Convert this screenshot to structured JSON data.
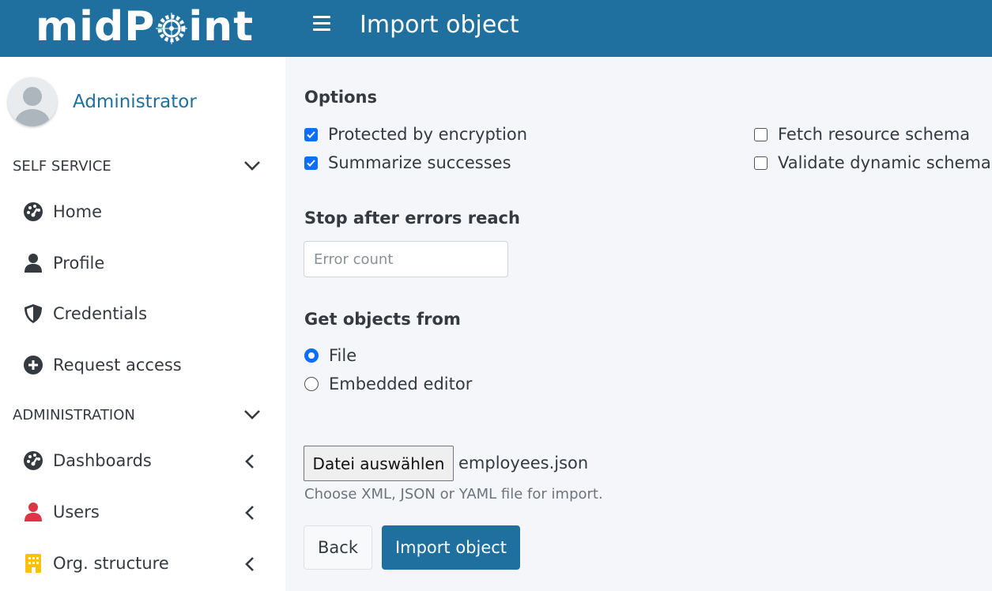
{
  "header": {
    "logo_text_left": "midP",
    "logo_text_right": "int",
    "page_title": "Import object"
  },
  "sidebar": {
    "user_name": "Administrator",
    "sections": [
      {
        "label": "SELF SERVICE",
        "expanded": true
      },
      {
        "label": "ADMINISTRATION",
        "expanded": true
      }
    ],
    "self_service_items": [
      {
        "label": "Home",
        "icon": "dashboard-gauge-icon"
      },
      {
        "label": "Profile",
        "icon": "user-icon"
      },
      {
        "label": "Credentials",
        "icon": "shield-icon"
      },
      {
        "label": "Request access",
        "icon": "plus-circle-icon"
      }
    ],
    "admin_items": [
      {
        "label": "Dashboards",
        "icon": "dashboard-gauge-icon",
        "color": "#343a40"
      },
      {
        "label": "Users",
        "icon": "user-icon",
        "color": "#dc3545"
      },
      {
        "label": "Org. structure",
        "icon": "building-icon",
        "color": "#ffc107"
      }
    ]
  },
  "main": {
    "options_heading": "Options",
    "options": [
      {
        "label": "Protected by encryption",
        "checked": true
      },
      {
        "label": "Summarize successes",
        "checked": true
      },
      {
        "label": "Fetch resource schema",
        "checked": false
      },
      {
        "label": "Validate dynamic schema",
        "checked": false
      }
    ],
    "stop_heading": "Stop after errors reach",
    "error_count_placeholder": "Error count",
    "source_heading": "Get objects from",
    "sources": [
      {
        "label": "File",
        "selected": true
      },
      {
        "label": "Embedded editor",
        "selected": false
      }
    ],
    "file_button_label": "Datei auswählen",
    "file_name": "employees.json",
    "file_help": "Choose XML, JSON or YAML file for import.",
    "back_label": "Back",
    "import_label": "Import object"
  },
  "colors": {
    "brand": "#1f6f9f",
    "checkbox_accent": "#0d6efd"
  }
}
